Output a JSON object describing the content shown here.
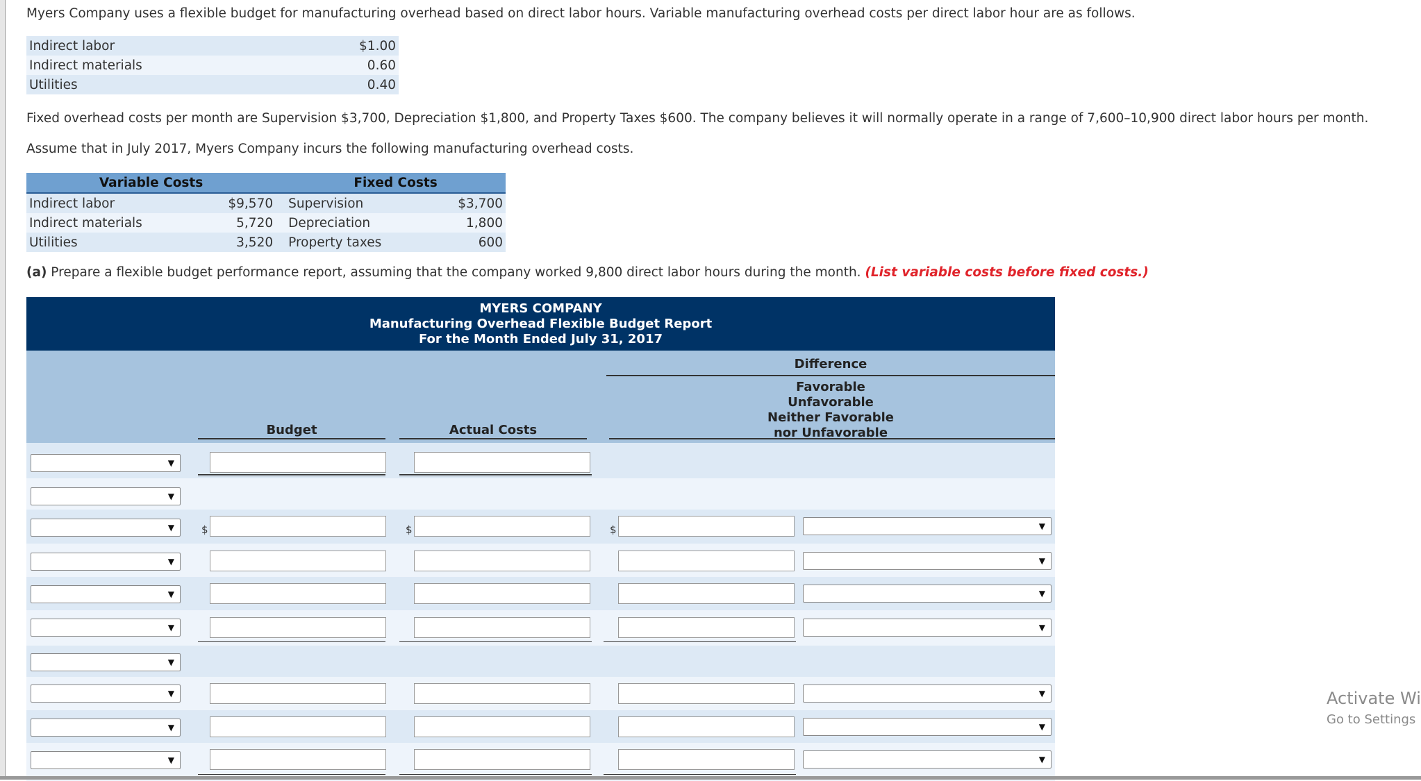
{
  "intro": "Myers Company uses a flexible budget for manufacturing overhead based on direct labor hours. Variable manufacturing overhead costs per direct labor hour are as follows.",
  "variable_rates": [
    {
      "label": "Indirect labor",
      "value": "$1.00"
    },
    {
      "label": "Indirect materials",
      "value": "0.60"
    },
    {
      "label": "Utilities",
      "value": "0.40"
    }
  ],
  "fixed_text": "Fixed overhead costs per month are Supervision $3,700, Depreciation $1,800, and Property Taxes $600. The company believes it will normally operate in a range of 7,600–10,900 direct labor hours per month.",
  "assume_text": "Assume that in July 2017, Myers Company incurs the following manufacturing overhead costs.",
  "costs_table": {
    "variable_header": "Variable Costs",
    "fixed_header": "Fixed Costs",
    "rows": [
      {
        "v_label": "Indirect labor",
        "v_value": "$9,570",
        "f_label": "Supervision",
        "f_value": "$3,700"
      },
      {
        "v_label": "Indirect materials",
        "v_value": "5,720",
        "f_label": "Depreciation",
        "f_value": "1,800"
      },
      {
        "v_label": "Utilities",
        "v_value": "3,520",
        "f_label": "Property taxes",
        "f_value": "600"
      }
    ]
  },
  "question": {
    "part": "(a)",
    "text": " Prepare a flexible budget performance report, assuming that the company worked 9,800 direct labor hours during the month. ",
    "note": "(List variable costs before fixed costs.)"
  },
  "report": {
    "company": "MYERS COMPANY",
    "title": "Manufacturing Overhead Flexible Budget Report",
    "period": "For the Month Ended July 31, 2017",
    "col_budget": "Budget",
    "col_actual": "Actual Costs",
    "col_difference": "Difference",
    "diff_options": [
      "Favorable",
      "Unfavorable",
      "Neither Favorable",
      "nor Unfavorable"
    ],
    "dollar_sign": "$",
    "dropdown_arrow": "▼"
  },
  "watermark": {
    "line1": "Activate Wi",
    "line2": "Go to Settings"
  }
}
